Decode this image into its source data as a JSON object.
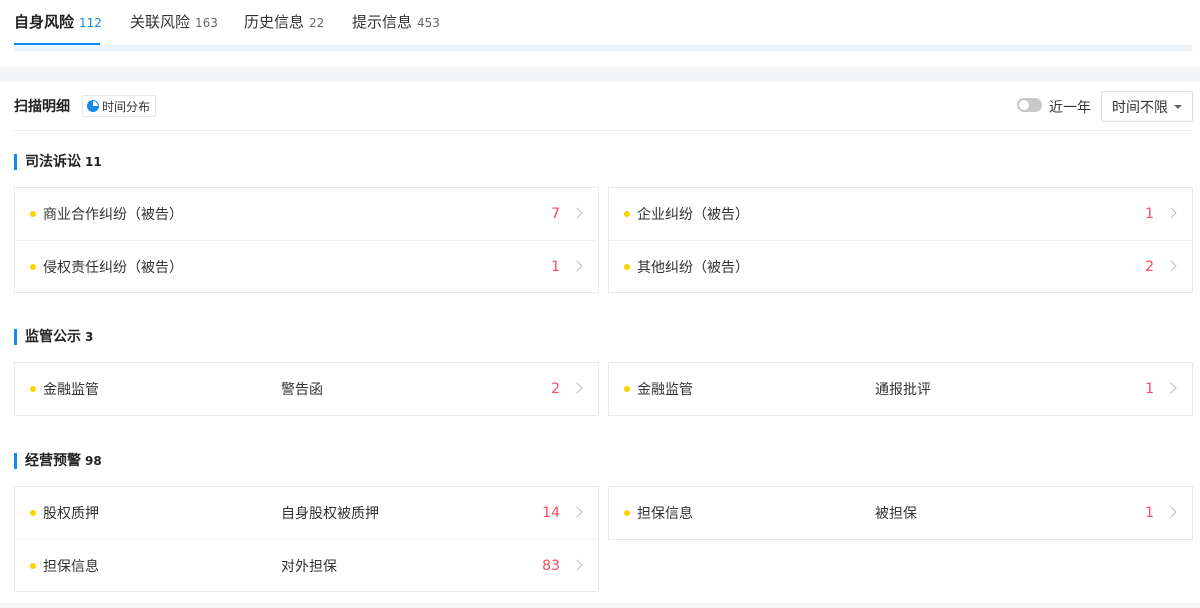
{
  "tabs": [
    {
      "label": "自身风险",
      "count": "112",
      "active": true
    },
    {
      "label": "关联风险",
      "count": "163"
    },
    {
      "label": "历史信息",
      "count": "22"
    },
    {
      "label": "提示信息",
      "count": "453"
    }
  ],
  "toolbar": {
    "title": "扫描明细",
    "distribution_label": "时间分布",
    "recent_year_label": "近一年",
    "time_select_value": "时间不限"
  },
  "sections": [
    {
      "title": "司法诉讼",
      "count": "11",
      "cards": [
        {
          "rows": [
            {
              "name": "商业合作纠纷（被告）",
              "sub": "",
              "value": "7"
            },
            {
              "name": "侵权责任纠纷（被告）",
              "sub": "",
              "value": "1"
            }
          ]
        },
        {
          "rows": [
            {
              "name": "企业纠纷（被告）",
              "sub": "",
              "value": "1"
            },
            {
              "name": "其他纠纷（被告）",
              "sub": "",
              "value": "2"
            }
          ]
        }
      ]
    },
    {
      "title": "监管公示",
      "count": "3",
      "cards": [
        {
          "rows": [
            {
              "name": "金融监管",
              "sub": "警告函",
              "value": "2"
            }
          ]
        },
        {
          "rows": [
            {
              "name": "金融监管",
              "sub": "通报批评",
              "value": "1"
            }
          ]
        }
      ]
    },
    {
      "title": "经营预警",
      "count": "98",
      "cards": [
        {
          "rows": [
            {
              "name": "股权质押",
              "sub": "自身股权被质押",
              "value": "14"
            },
            {
              "name": "担保信息",
              "sub": "对外担保",
              "value": "83"
            }
          ]
        },
        {
          "rows": [
            {
              "name": "担保信息",
              "sub": "被担保",
              "value": "1"
            }
          ]
        }
      ]
    }
  ],
  "colors": {
    "accent": "#128bed",
    "value": "#fd485e",
    "dot": "#ffd100"
  }
}
